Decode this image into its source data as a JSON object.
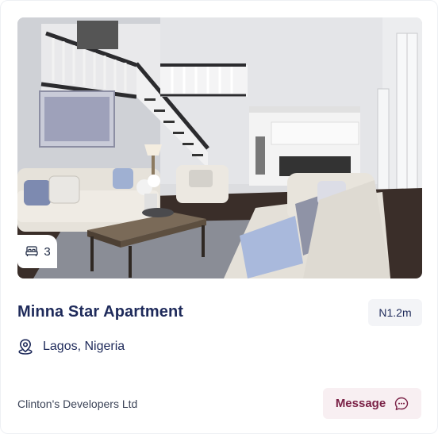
{
  "listing": {
    "image_alt": "Bright open-plan living room with sofas and staircase",
    "rooms_icon": "bed-icon",
    "rooms_count": "3",
    "title": "Minna Star Apartment",
    "price": "N1.2m",
    "location_icon": "location-pin-icon",
    "location": "Lagos, Nigeria",
    "developer": "Clinton's Developers Ltd",
    "message_label": "Message",
    "message_icon": "chat-bubble-icon"
  },
  "colors": {
    "title": "#1e2a5a",
    "accent": "#7a2146",
    "button_bg": "#f8eff2",
    "price_bg": "#f3f4f7"
  }
}
